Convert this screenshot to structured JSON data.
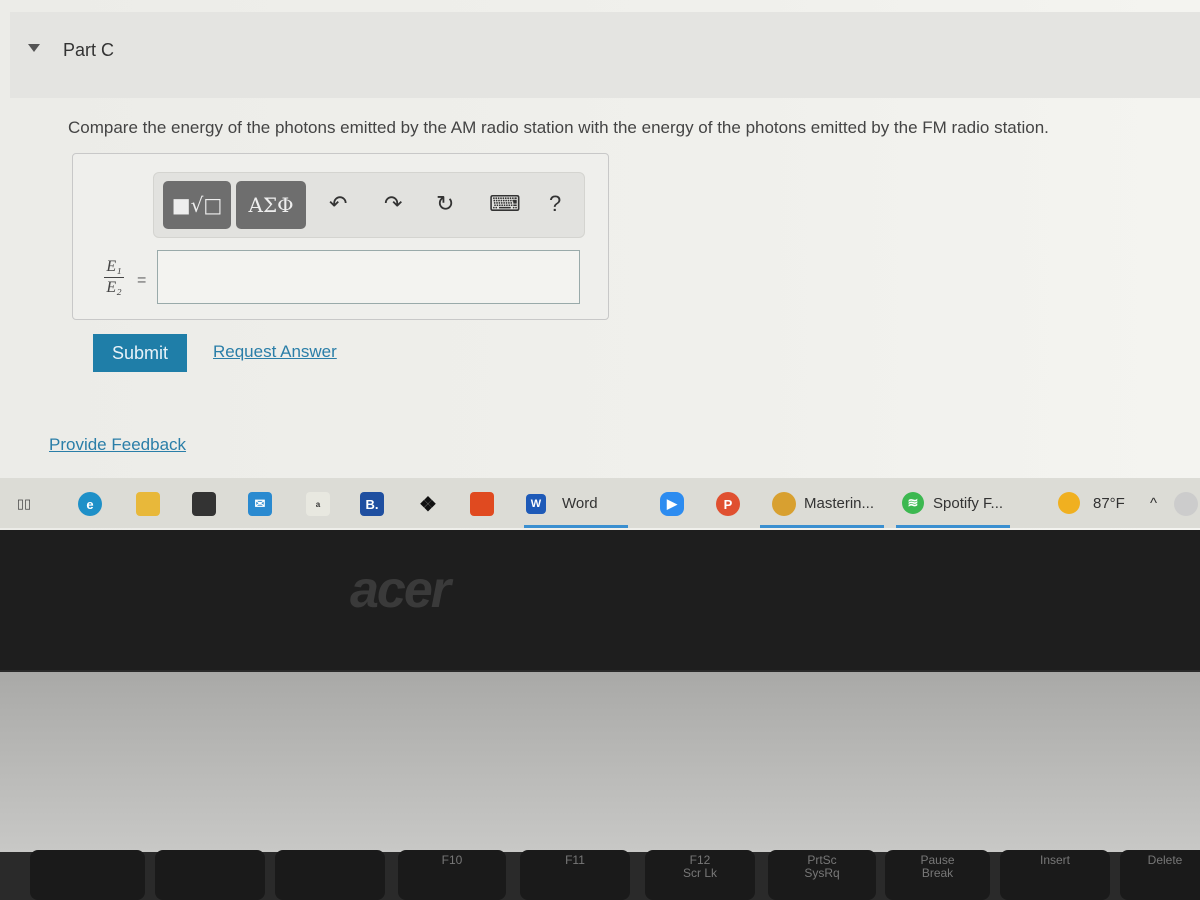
{
  "part": {
    "title": "Part C"
  },
  "question": "Compare the energy of the photons emitted by the AM radio station with the energy of the photons emitted by the FM radio station.",
  "toolbar": {
    "templates": "■√□",
    "greek": "ΑΣΦ",
    "undo": "↶",
    "redo": "↷",
    "reset": "↻",
    "keyboard": "⌨",
    "help": "?"
  },
  "answer": {
    "lhs_num": "E₁",
    "lhs_den": "E₂",
    "equals": "=",
    "value": ""
  },
  "actions": {
    "submit": "Submit",
    "request_answer": "Request Answer",
    "feedback": "Provide Feedback"
  },
  "taskbar": {
    "word": "Word",
    "mastering": "Masterin...",
    "spotify": "Spotify F...",
    "temperature": "87°F",
    "booking": "B."
  },
  "laptop": {
    "brand": "acer",
    "keys": [
      "F10",
      "F11",
      "F12\nScr Lk",
      "PrtSc\nSysRq",
      "Pause\nBreak",
      "Insert",
      "Delete"
    ]
  }
}
